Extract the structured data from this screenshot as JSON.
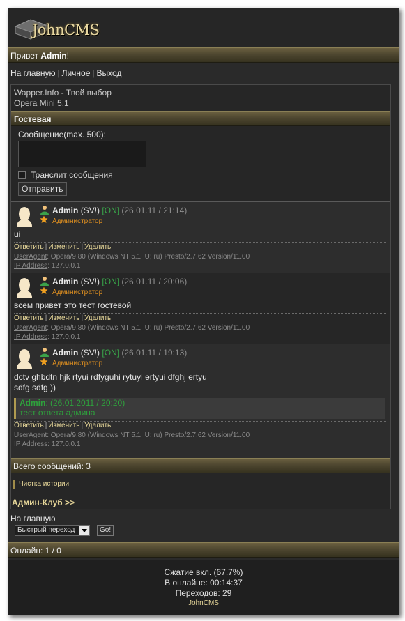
{
  "logo": {
    "text": "JohnCMS"
  },
  "greeting": {
    "prefix": "Привет ",
    "name": "Admin",
    "suffix": "!"
  },
  "topnav": {
    "home": "На главную",
    "personal": "Личное",
    "exit": "Выход"
  },
  "phone_info": {
    "line1": "Wapper.Info - Твой выбор",
    "line2": "Opera Mini 5.1"
  },
  "guestbook": {
    "title": "Гостевая",
    "message_label": "Сообщение(max. 500):",
    "message_value": "",
    "translit_label": "Транслит сообщения",
    "submit_label": "Отправить"
  },
  "posts": [
    {
      "nick": "Admin",
      "sv": "(SV!)",
      "status": "[ON]",
      "date": "(26.01.11 / 21:14)",
      "role": "Администратор",
      "text": [
        "ui"
      ],
      "actions": {
        "reply": "Ответить",
        "edit": "Изменить",
        "delete": "Удалить"
      },
      "ua_key": "UserAgent",
      "ua_value": ": Opera/9.80 (Windows NT 5.1; U; ru) Presto/2.7.62 Version/11.00",
      "ip_key": "IP Address",
      "ip_value": ": 127.0.0.1"
    },
    {
      "nick": "Admin",
      "sv": "(SV!)",
      "status": "[ON]",
      "date": "(26.01.11 / 20:06)",
      "role": "Администратор",
      "text": [
        "всем привет это тест гостевой"
      ],
      "actions": {
        "reply": "Ответить",
        "edit": "Изменить",
        "delete": "Удалить"
      },
      "ua_key": "UserAgent",
      "ua_value": ": Opera/9.80 (Windows NT 5.1; U; ru) Presto/2.7.62 Version/11.00",
      "ip_key": "IP Address",
      "ip_value": ": 127.0.0.1"
    },
    {
      "nick": "Admin",
      "sv": "(SV!)",
      "status": "[ON]",
      "date": "(26.01.11 / 19:13)",
      "role": "Администратор",
      "text": [
        "dctv ghbdtn hjk rtyui rdfyguhi rytuyi ertyui dfghj ertyu",
        "sdfg sdfg ))"
      ],
      "reply": {
        "author": "Admin",
        "date": ": (26.01.2011 / 20:20)",
        "text": "тест ответа админа"
      },
      "actions": {
        "reply": "Ответить",
        "edit": "Изменить",
        "delete": "Удалить"
      },
      "ua_key": "UserAgent",
      "ua_value": ": Opera/9.80 (Windows NT 5.1; U; ru) Presto/2.7.62 Version/11.00",
      "ip_key": "IP Address",
      "ip_value": ": 127.0.0.1"
    }
  ],
  "total": "Всего сообщений: 3",
  "clear_history": "Чистка истории",
  "admin_club": "Админ-Клуб >>",
  "bottom_home": "На главную",
  "quick_nav": {
    "selected": "Быстрый переход",
    "go": "Go!"
  },
  "online": "Онлайн: 1 / 0",
  "footer": {
    "compression": "Сжатие вкл. (67.7%)",
    "online_time": "В онлайне: 00:14:37",
    "transitions": "Переходов: 29",
    "brand": "JohnCMS"
  },
  "colors": {
    "bar_gold": "#4e4730",
    "link_gold": "#e8d89a",
    "online_green": "#39a84a",
    "role_orange": "#e09020"
  },
  "icons": [
    "cube-logo-icon",
    "user-icon",
    "star-icon",
    "avatar-silhouette-icon",
    "dropdown-arrow-icon",
    "checkbox-icon"
  ]
}
